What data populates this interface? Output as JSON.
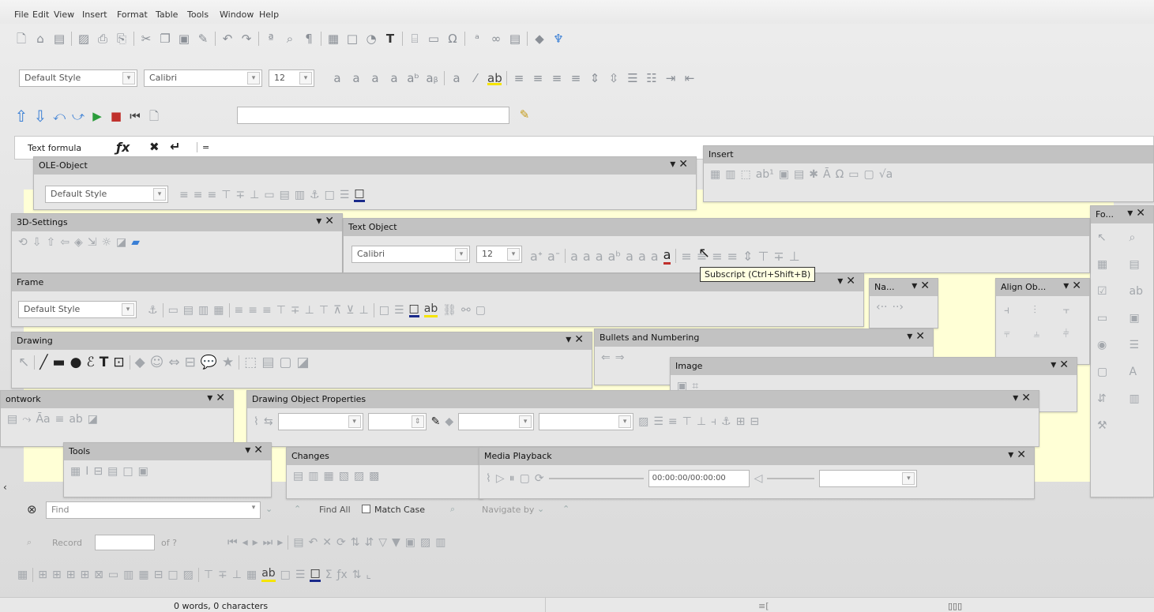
{
  "menu": [
    "File",
    "Edit",
    "View",
    "Insert",
    "Format",
    "Table",
    "Tools",
    "Window",
    "Help"
  ],
  "format_bar": {
    "paragraph_style": "Default Style",
    "font_name": "Calibri",
    "font_size": "12"
  },
  "formula_bar": {
    "label": "Text formula",
    "equals": "="
  },
  "panels": {
    "ole": {
      "title": "OLE-Object",
      "style": "Default Style"
    },
    "insert": {
      "title": "Insert"
    },
    "fo": {
      "title": "Fo..."
    },
    "settings3d": {
      "title": "3D-Settings"
    },
    "text_object": {
      "title": "Text Object",
      "font": "Calibri",
      "size": "12"
    },
    "frame": {
      "title": "Frame",
      "style": "Default Style"
    },
    "na": {
      "title": "Na..."
    },
    "align": {
      "title": "Align Ob..."
    },
    "drawing": {
      "title": "Drawing"
    },
    "bullets": {
      "title": "Bullets and Numbering"
    },
    "image": {
      "title": "Image"
    },
    "fontwork": {
      "title": "ontwork"
    },
    "dop": {
      "title": "Drawing Object Properties"
    },
    "tools": {
      "title": "Tools"
    },
    "changes": {
      "title": "Changes"
    },
    "media": {
      "title": "Media Playback",
      "time": "00:00:00/00:00:00"
    }
  },
  "tooltip": "Subscript (Ctrl+Shift+B)",
  "find": {
    "placeholder": "Find",
    "find_all": "Find All",
    "match_case": "Match Case",
    "navigate_by": "Navigate by"
  },
  "record": {
    "label": "Record",
    "of": "of ?"
  },
  "status": {
    "words": "0 words, 0 characters"
  },
  "colors": {
    "title_bar": "#c2c2c2",
    "doc_yellow": "#ffffd6",
    "accent_blue": "#3a7fd5",
    "accent_red": "#c0302c",
    "highlight": "#f5e400"
  }
}
